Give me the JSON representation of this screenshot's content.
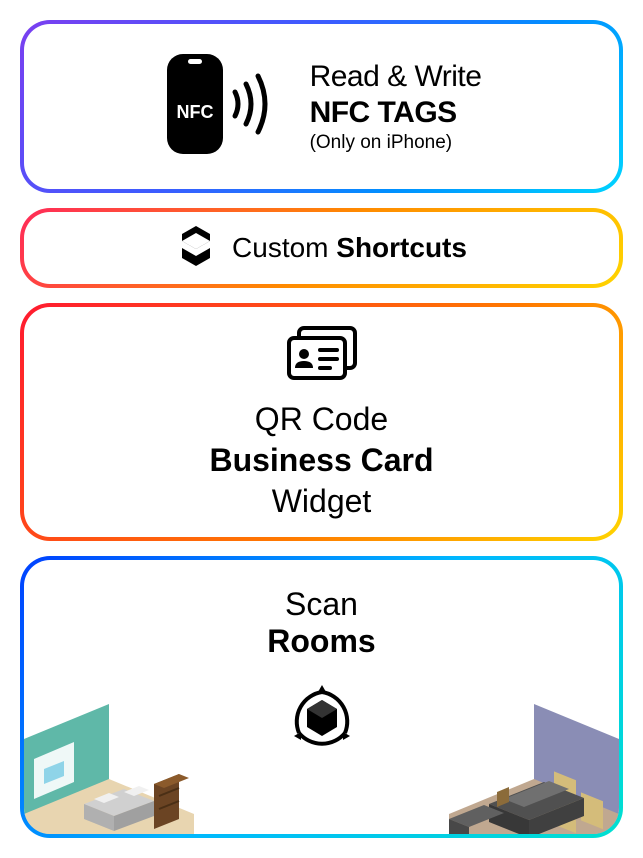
{
  "nfc": {
    "line1": "Read & Write",
    "line2": "NFC TAGS",
    "line3": "(Only on iPhone)",
    "badge": "NFC"
  },
  "shortcuts": {
    "prefix": "Custom ",
    "bold": "Shortcuts"
  },
  "qr": {
    "line1": "QR Code",
    "line2": "Business Card",
    "line3": "Widget"
  },
  "rooms": {
    "line1": "Scan",
    "line2": "Rooms"
  }
}
